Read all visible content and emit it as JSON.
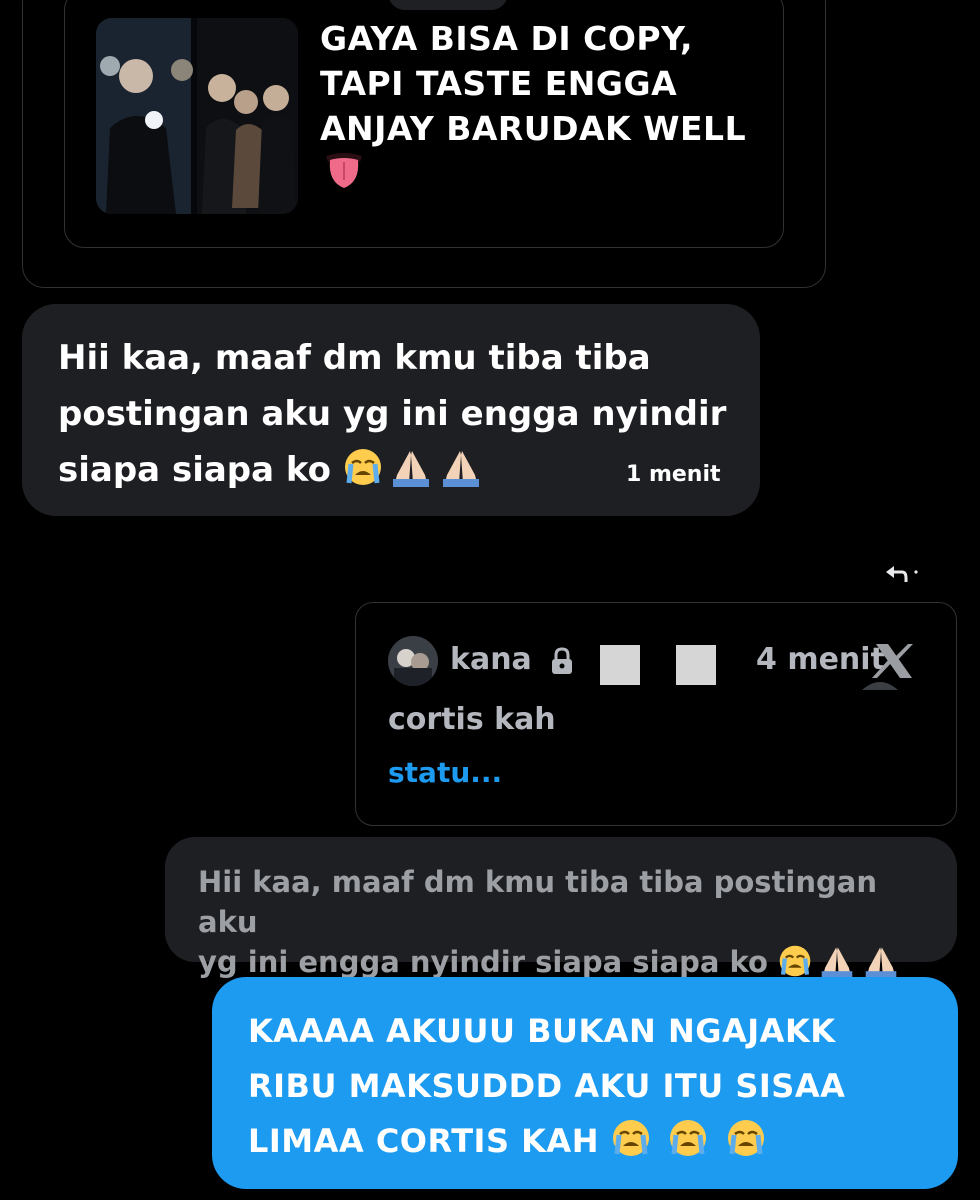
{
  "shared_post": {
    "text": "GAYA BISA DI COPY,\nTAPI TASTE ENGGA\nANJAY BARUDAK WELL",
    "emoji": "tongue-emoji"
  },
  "received_message": {
    "text": "Hii kaa, maaf dm kmu tiba tiba\npostingan aku yg ini engga nyindir\nsiapa siapa ko",
    "emojis": [
      "loudly-crying-face",
      "folded-hands",
      "folded-hands"
    ],
    "time": "1 menit"
  },
  "reply_icon": "reply-arrow-icon",
  "quoted_tweet": {
    "author": "kana",
    "time": "4 menit",
    "text": "cortis kah",
    "link_text": "statu..."
  },
  "replied_to": {
    "text": "Hii kaa, maaf dm kmu tiba tiba postingan aku\nyg ini engga nyindir siapa siapa ko",
    "emojis": [
      "loudly-crying-face",
      "folded-hands",
      "folded-hands"
    ]
  },
  "sent_message": {
    "text": "KAAAA AKUUU BUKAN NGAJAKK\nRIBU MAKSUDDD AKU ITU SISAA\nLIMAA CORTIS KAH",
    "emojis": [
      "loudly-crying-face",
      "loudly-crying-face",
      "loudly-crying-face"
    ]
  },
  "colors": {
    "background": "#000000",
    "bubble_dark": "#1e1f23",
    "bubble_blue": "#1d9bf0",
    "link_blue": "#1d9bf0",
    "muted_text": "#b4b8be"
  }
}
